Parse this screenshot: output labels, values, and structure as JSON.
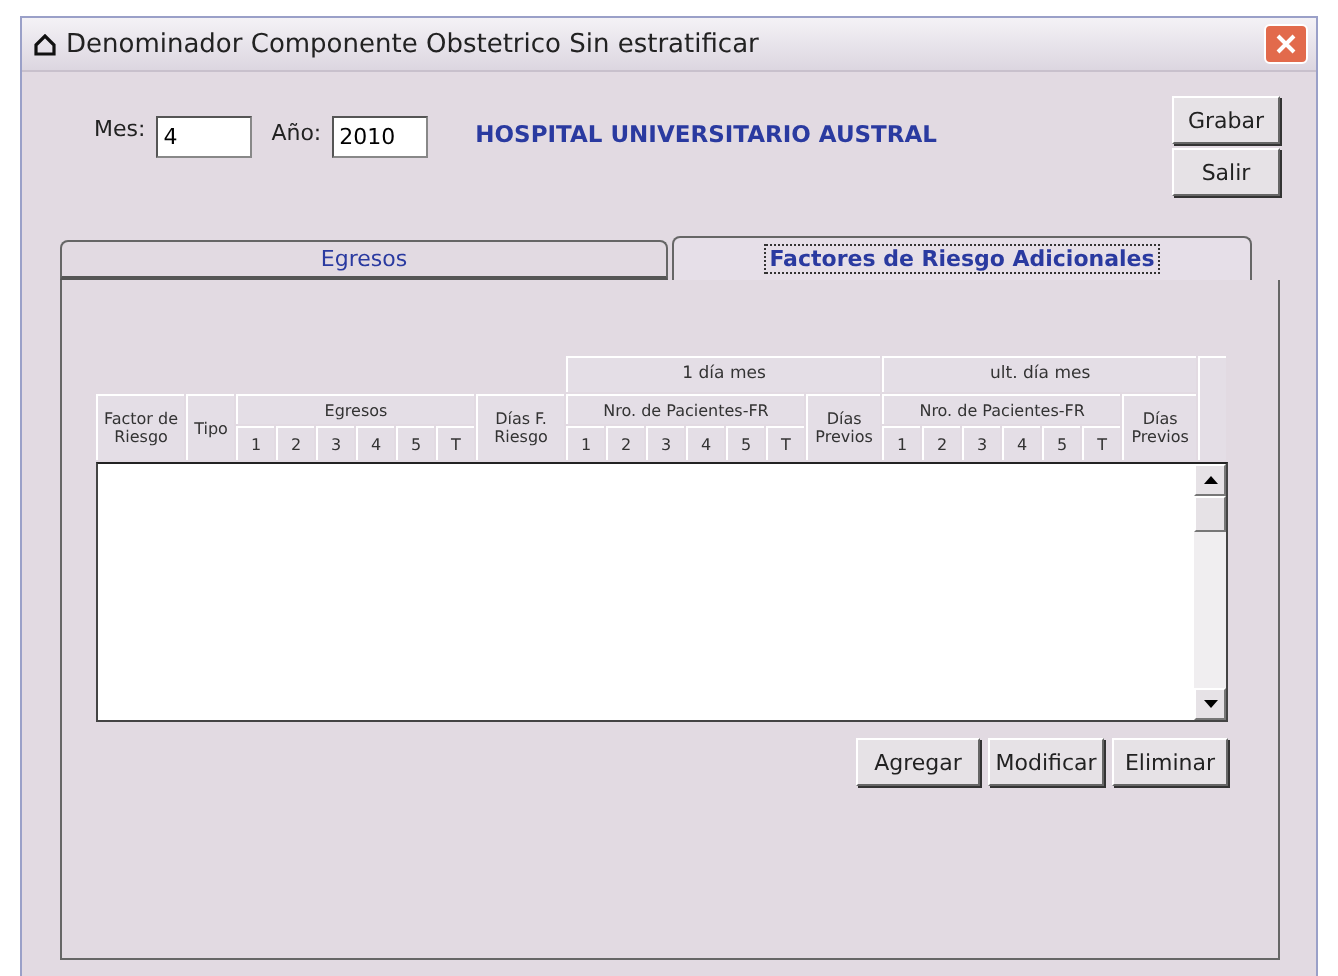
{
  "window": {
    "title": "Denominador Componente Obstetrico Sin estratificar"
  },
  "period": {
    "month_label": "Mes:",
    "month": "4",
    "year_label": "Año:",
    "year": "2010"
  },
  "hospital": "HOSPITAL UNIVERSITARIO AUSTRAL",
  "actions": [
    "Grabar",
    "Salir"
  ],
  "tabs": [
    {
      "label": "Egresos",
      "selected": false
    },
    {
      "label": "Factores de Riesgo Adicionales",
      "selected": true
    }
  ],
  "grid": {
    "factor": "Factor de Riesgo",
    "tipo": "Tipo",
    "egresos": {
      "label": "Egresos",
      "columns": [
        "1",
        "2",
        "3",
        "4",
        "5",
        "T"
      ]
    },
    "dias_riesgo": "Días F. Riesgo",
    "periods": [
      {
        "label": "1 día mes",
        "patients": {
          "label": "Nro. de Pacientes-FR",
          "columns": [
            "1",
            "2",
            "3",
            "4",
            "5",
            "T"
          ]
        },
        "previous_days": "Días Previos"
      },
      {
        "label": "ult. día mes",
        "patients": {
          "label": "Nro. de Pacientes-FR",
          "columns": [
            "1",
            "2",
            "3",
            "4",
            "5",
            "T"
          ]
        },
        "previous_days": "Días Previos"
      }
    ]
  },
  "list_buttons": [
    "Agregar",
    "Modificar",
    "Eliminar"
  ]
}
